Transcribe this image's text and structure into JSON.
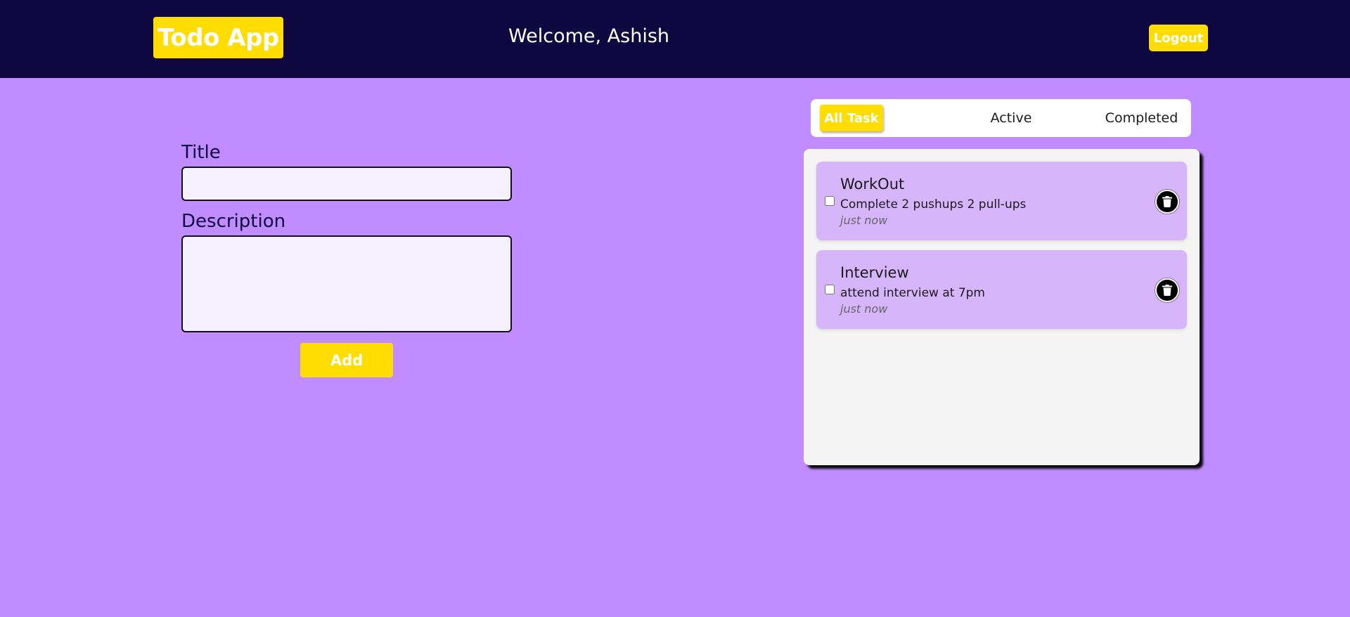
{
  "header": {
    "logo_text": "Todo App",
    "welcome_text": "Welcome, Ashish",
    "logout_label": "Logout"
  },
  "form": {
    "title_label": "Title",
    "title_value": "",
    "description_label": "Description",
    "description_value": "",
    "add_label": "Add"
  },
  "filters": {
    "tabs": [
      {
        "label": "All Task",
        "selected": true
      },
      {
        "label": "Active",
        "selected": false
      },
      {
        "label": "Completed",
        "selected": false
      }
    ]
  },
  "tasks": [
    {
      "title": "WorkOut",
      "description": "Complete 2 pushups 2 pull-ups",
      "time": "just now",
      "completed": false
    },
    {
      "title": "Interview",
      "description": "attend interview at 7pm",
      "time": "just now",
      "completed": false
    }
  ],
  "icons": {
    "delete": "trash-icon"
  },
  "colors": {
    "header_bg": "#0f0840",
    "page_bg": "#c08cff",
    "accent": "#ffdd00",
    "card_bg": "#d7b5fb",
    "panel_bg": "#f4f4f4"
  }
}
